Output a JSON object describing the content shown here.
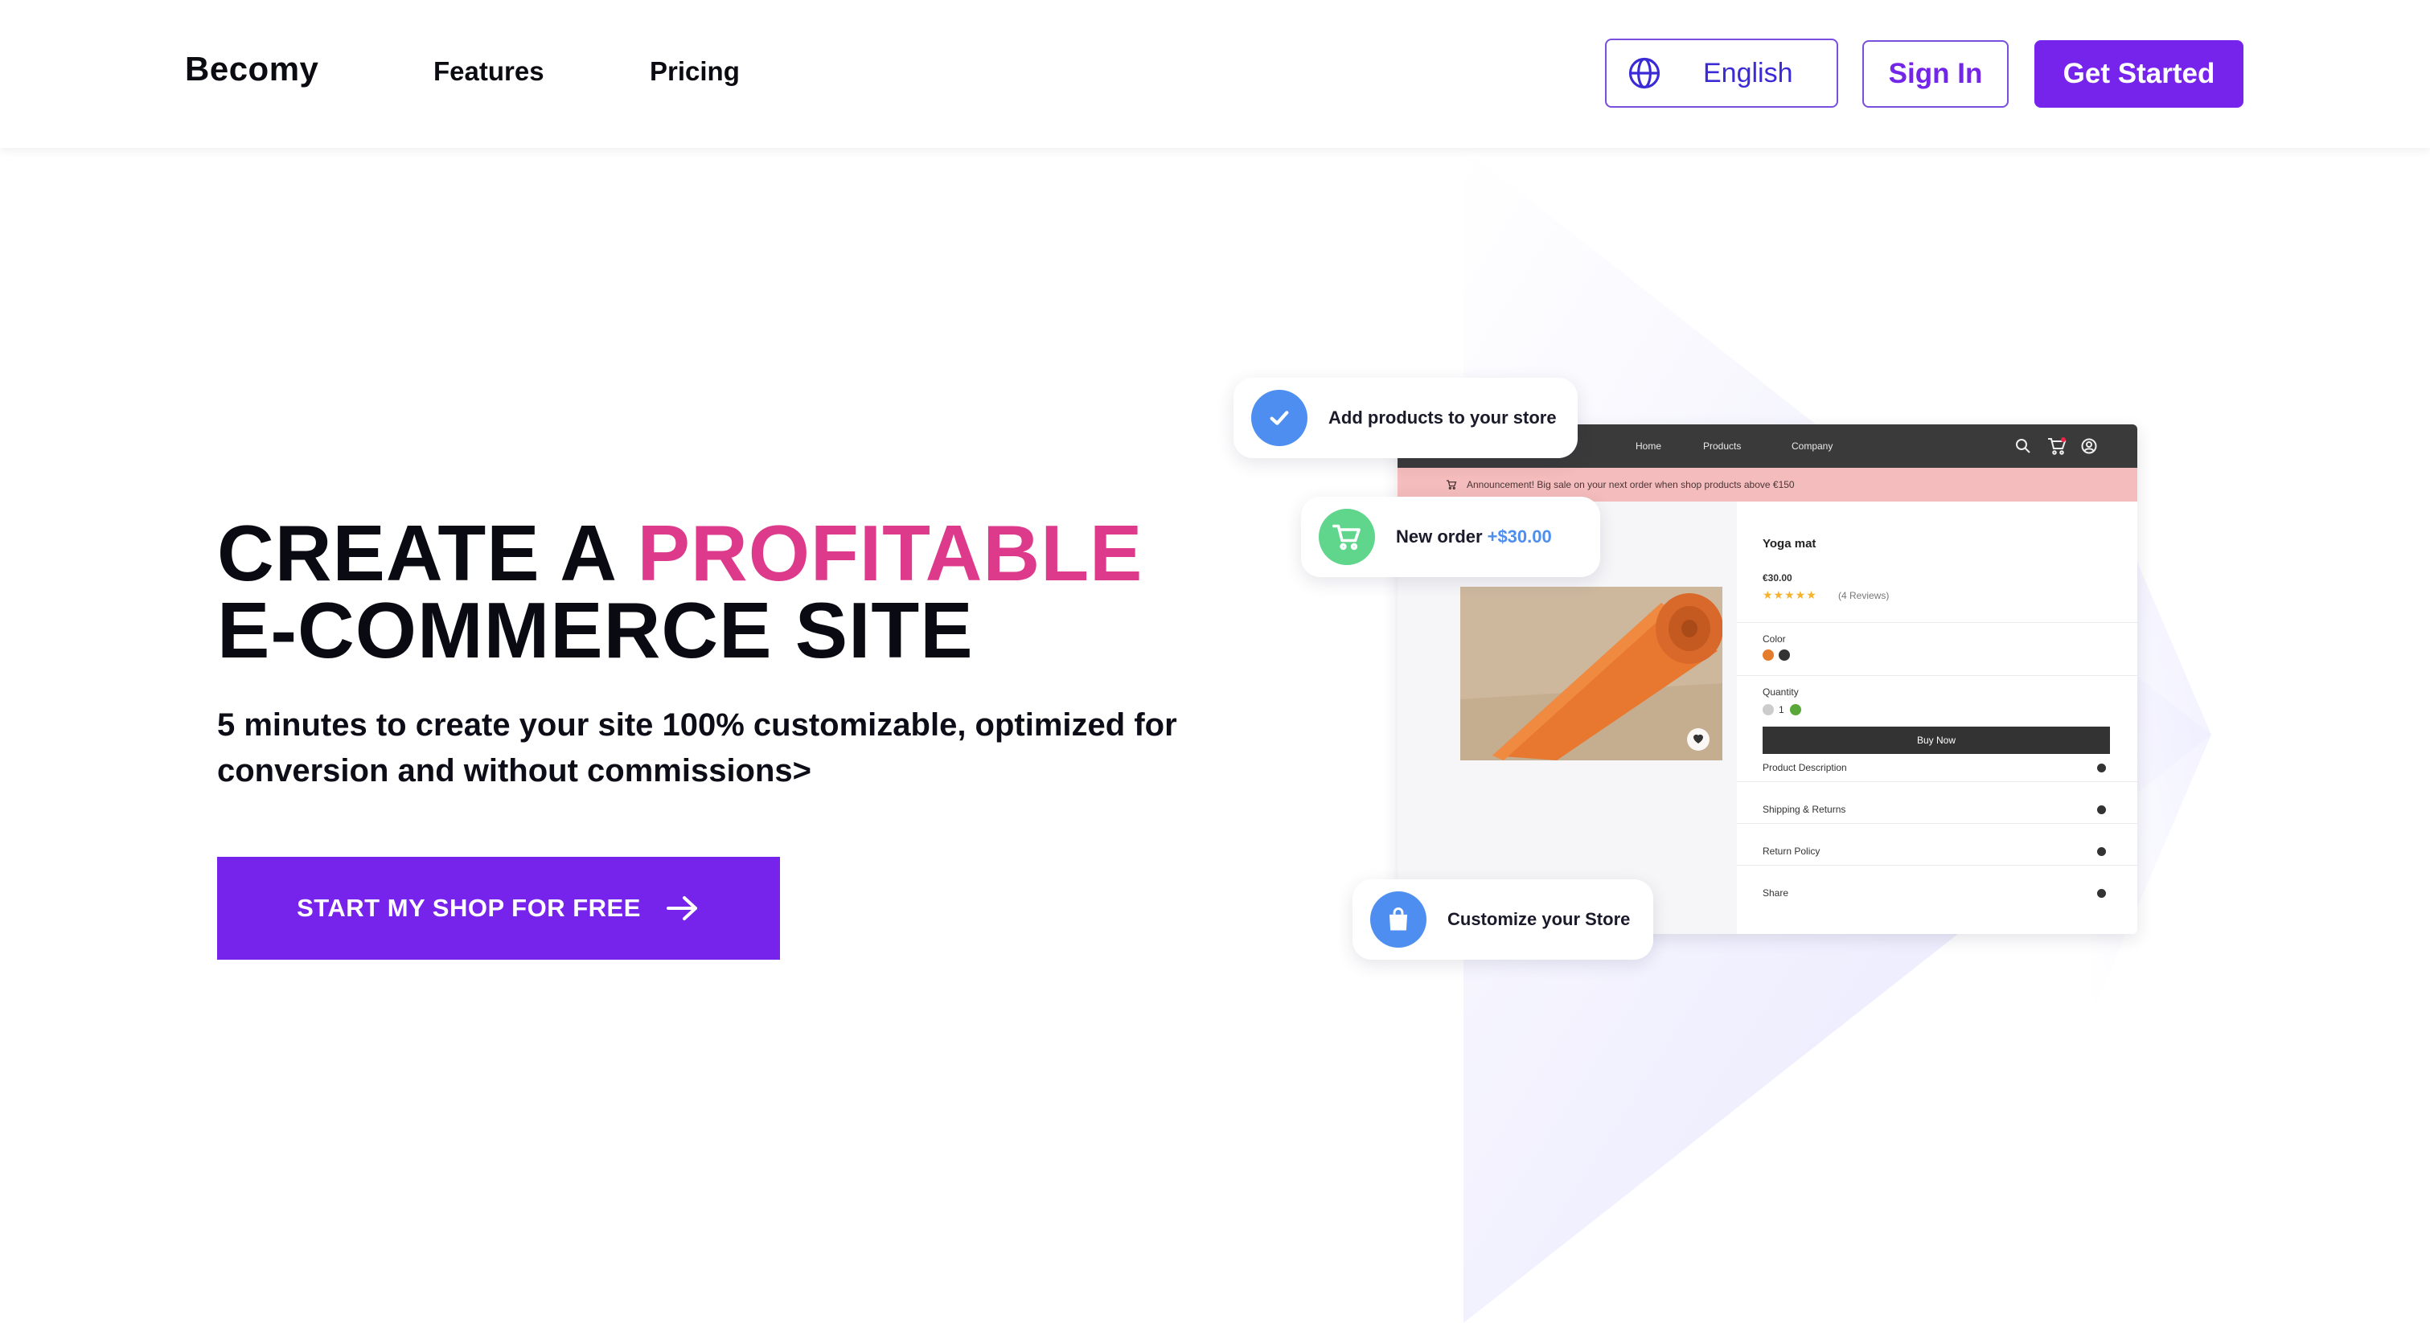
{
  "nav": {
    "brand": "Becomy",
    "links": [
      "Features",
      "Pricing"
    ],
    "language": "English",
    "sign_in": "Sign In",
    "get_started": "Get Started"
  },
  "hero": {
    "title_part1": "CREATE A",
    "title_accent": "PROFITABLE",
    "title_line2": "E-COMMERCE SITE",
    "subtitle": "5 minutes to create your site 100% customizable, optimized for conversion and without commissions>",
    "cta": "START MY SHOP FOR FREE"
  },
  "mockup": {
    "nav_links": [
      "Home",
      "Products",
      "Company"
    ],
    "announcement": "Announcement! Big sale on your next order when shop products above €150",
    "product_name": "Yoga mat",
    "price": "€30.00",
    "reviews": "(4 Reviews)",
    "color_label": "Color",
    "quantity_label": "Quantity",
    "quantity_value": "1",
    "buy_now": "Buy Now",
    "accordion": [
      "Product Description",
      "Shipping & Returns",
      "Return Policy",
      "Share"
    ]
  },
  "badges": {
    "add_products": "Add products to your store",
    "new_order": "New order",
    "new_order_value": "+$30.00",
    "customize": "Customize your Store"
  },
  "colors": {
    "primary": "#7624eb",
    "accent": "#de3a8c",
    "announcement_bg": "#f4bcbc",
    "check_blue": "#4d8ef0",
    "cart_green": "#5fd68b"
  }
}
